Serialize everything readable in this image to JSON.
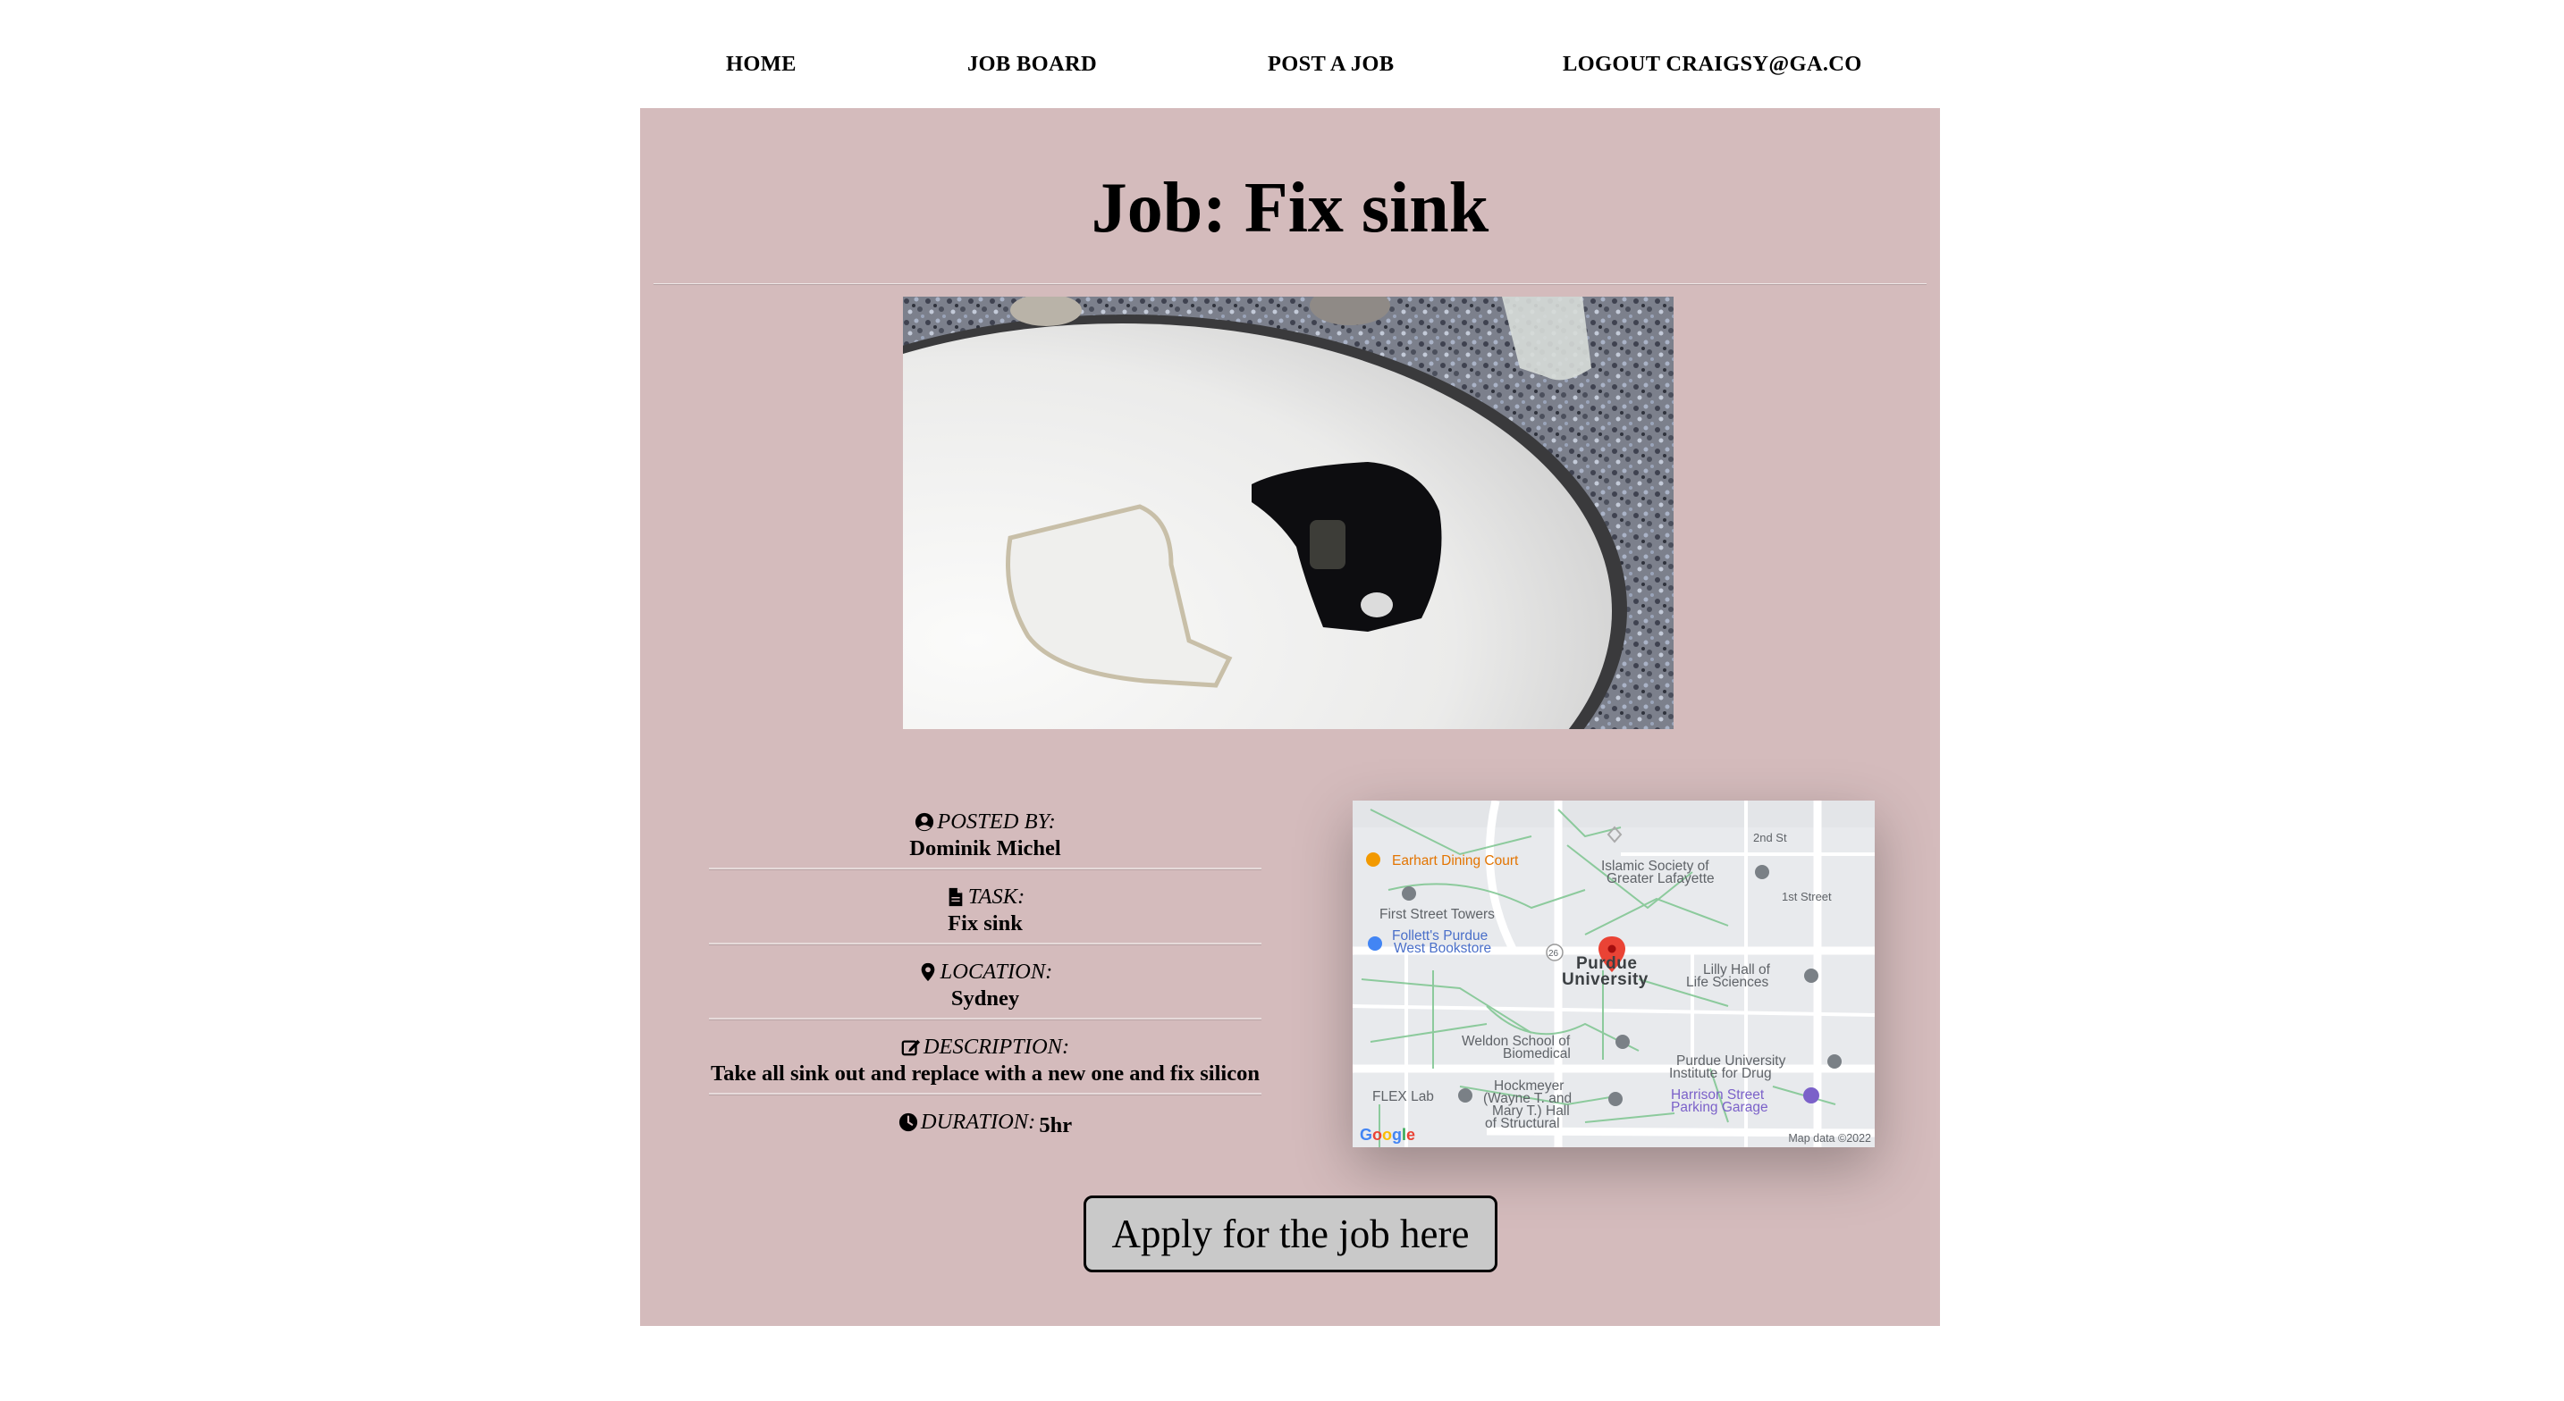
{
  "nav": {
    "home": "HOME",
    "job_board": "JOB BOARD",
    "post_job": "POST A JOB",
    "logout": "LOGOUT CRAIGSY@GA.CO"
  },
  "job": {
    "title": "Job: Fix sink",
    "posted_by_label": "POSTED BY:",
    "posted_by": "Dominik Michel",
    "task_label": "TASK:",
    "task": "Fix sink",
    "location_label": "LOCATION:",
    "location": "Sydney",
    "description_label": "DESCRIPTION:",
    "description": "Take all sink out and replace with a new one and fix silicon",
    "duration_label": "DURATION:",
    "duration": "5hr",
    "apply_label": "Apply for the job here"
  },
  "map": {
    "labels": {
      "earhart": "Earhart Dining Court",
      "islamic": "Islamic Society of",
      "islamic2": "Greater Lafayette",
      "second_st": "2nd St",
      "first_st": "1st Street",
      "first_towers": "First Street Towers",
      "folletts": "Follett's Purdue",
      "folletts2": "West Bookstore",
      "route": "26",
      "purdue": "Purdue",
      "purdue2": "University",
      "lilly": "Lilly Hall of",
      "lilly2": "Life Sciences",
      "weldon": "Weldon School of",
      "weldon2": "Biomedical",
      "pu_inst": "Purdue University",
      "pu_inst2": "Institute for Drug",
      "flex": "FLEX Lab",
      "hock1": "Hockmeyer",
      "hock2": "(Wayne T. and",
      "hock3": "Mary T.) Hall",
      "hock4": "of Structural",
      "harrison": "Harrison Street",
      "harrison2": "Parking Garage"
    },
    "logo": "Google",
    "credit": "Map data ©2022"
  },
  "colors": {
    "card_background": "#d4bbbc",
    "button_background": "#c9c9c9",
    "map_pin": "#ea4335"
  }
}
